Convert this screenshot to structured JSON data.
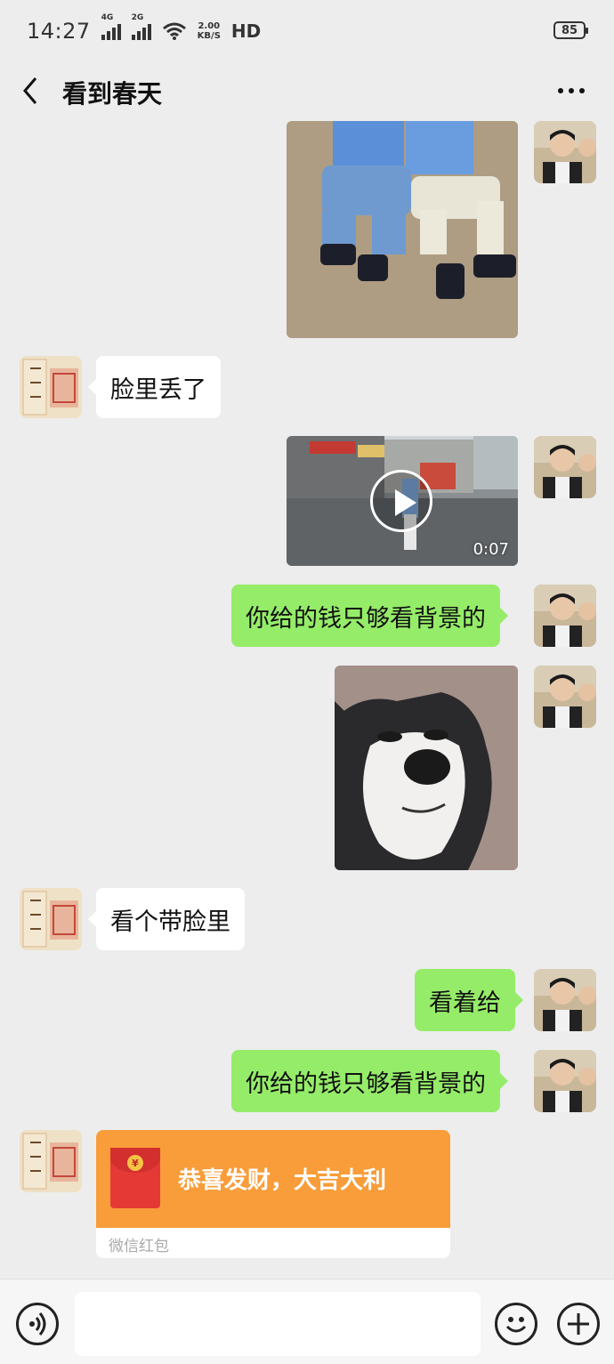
{
  "status_bar": {
    "time": "14:27",
    "signal1_label": "4G",
    "signal2_label": "2G",
    "net_speed_value": "2.00",
    "net_speed_unit": "KB/S",
    "hd_label": "HD",
    "battery": "85"
  },
  "header": {
    "title": "看到春天",
    "back_icon": "chevron-left-icon",
    "more_icon": "more-dots-icon"
  },
  "messages": [
    {
      "side": "right",
      "type": "image",
      "desc_icon": "photo"
    },
    {
      "side": "left",
      "type": "text",
      "text": "脸里丢了"
    },
    {
      "side": "right",
      "type": "video",
      "duration": "0:07"
    },
    {
      "side": "right",
      "type": "text",
      "text": "你给的钱只够看背景的"
    },
    {
      "side": "right",
      "type": "image",
      "desc_icon": "photo"
    },
    {
      "side": "left",
      "type": "text",
      "text": "看个带脸里"
    },
    {
      "side": "right",
      "type": "text",
      "text": "看着给"
    },
    {
      "side": "right",
      "type": "text",
      "text": "你给的钱只够看背景的"
    },
    {
      "side": "left",
      "type": "red_packet",
      "text": "恭喜发财，大吉大利",
      "label": "微信红包",
      "coin": "¥"
    }
  ],
  "input_bar": {
    "placeholder": "",
    "voice_icon": "voice-icon",
    "emoji_icon": "emoji-icon",
    "plus_icon": "plus-icon"
  },
  "colors": {
    "background": "#ededed",
    "bubble_right": "#95ec69",
    "bubble_left": "#ffffff",
    "red_packet": "#f89d3a"
  }
}
